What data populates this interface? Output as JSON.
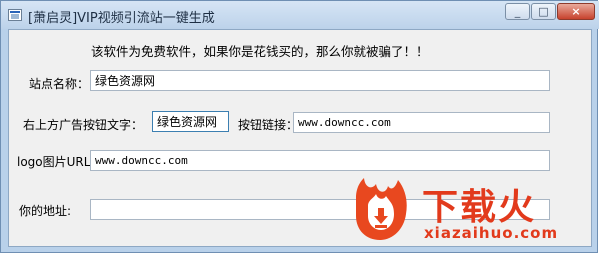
{
  "window": {
    "title": "[萧启灵]VIP视频引流站一键生成",
    "controls": {
      "minimize": "_",
      "maximize": "□",
      "close": "×"
    }
  },
  "form": {
    "notice": "该软件为免费软件，如果你是花钱买的，那么你就被骗了！！",
    "site_name_label": "站点名称：",
    "site_name_value": "绿色资源网",
    "button_text_label": "右上方广告按钮文字：",
    "button_text_value": "绿色资源网",
    "button_link_label": "按钮链接：",
    "button_link_value": "www.downcc.com",
    "logo_url_label": "logo图片URL:",
    "logo_url_value": "www.downcc.com",
    "your_address_label": "你的地址:",
    "your_address_value": ""
  },
  "watermark": {
    "brand_cn": "下载火",
    "brand_en": "xiazaihuo.com",
    "color": "#e23a1c",
    "icon": "fire-download-logo"
  }
}
